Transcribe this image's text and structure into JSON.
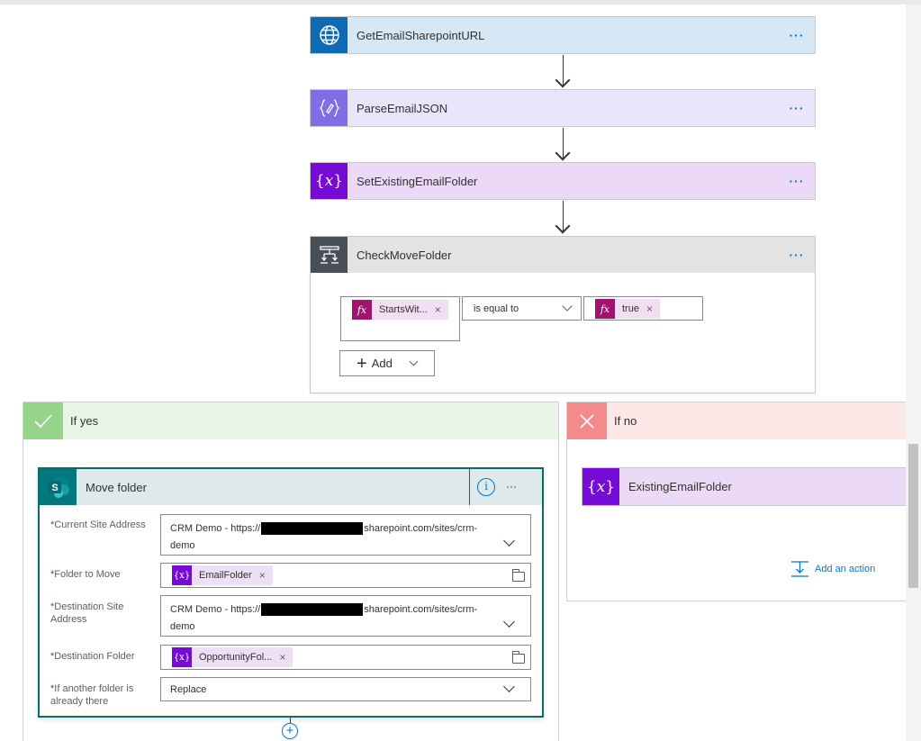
{
  "flow": {
    "actions": [
      {
        "label": "GetEmailSharepointURL",
        "more": "···",
        "icon": "globe-icon"
      },
      {
        "label": "ParseEmailJSON",
        "more": "···",
        "icon": "data-operation-icon"
      },
      {
        "label": "SetExistingEmailFolder",
        "more": "···",
        "icon": "variable-icon"
      }
    ],
    "condition": {
      "label": "CheckMoveFolder",
      "more": "···",
      "left_token": "StartsWit...",
      "operator": "is equal to",
      "right_token": "true",
      "add_label": "Add"
    },
    "yes_branch": {
      "label": "If yes",
      "action": {
        "label": "Move folder",
        "more": "···",
        "fields": [
          {
            "label": "Current Site Address",
            "value_prefix": "CRM Demo - https://",
            "value_suffix": "sharepoint.com/sites/crm-",
            "value_line2": "demo"
          },
          {
            "label": "Folder to Move",
            "token": "EmailFolder"
          },
          {
            "label": "Destination Site Address",
            "value_prefix": "CRM Demo - https://",
            "value_suffix": "sharepoint.com/sites/crm-",
            "value_line2": "demo"
          },
          {
            "label": "Destination Folder",
            "token": "OpportunityFol..."
          },
          {
            "label": "If another folder is already there",
            "value": "Replace"
          }
        ]
      }
    },
    "no_branch": {
      "label": "If no",
      "action_label": "ExistingEmailFolder",
      "add_action": "Add an action"
    }
  },
  "colors": {
    "http_header": "#d6e8f5",
    "http_icon": "#0f6ab4",
    "parse_header": "#ebe5fb",
    "parse_icon": "#7f6ee6",
    "variable_header": "#ebd9f5",
    "variable_icon": "#770bd6",
    "condition_header": "#e3e3e3",
    "condition_icon": "#484f58",
    "yes_header": "#e8f5e6",
    "yes_icon": "#96d48a",
    "no_header": "#fde8e8",
    "no_icon": "#f38b8b",
    "sharepoint_icon": "#03787c",
    "link": "#0078d4"
  }
}
